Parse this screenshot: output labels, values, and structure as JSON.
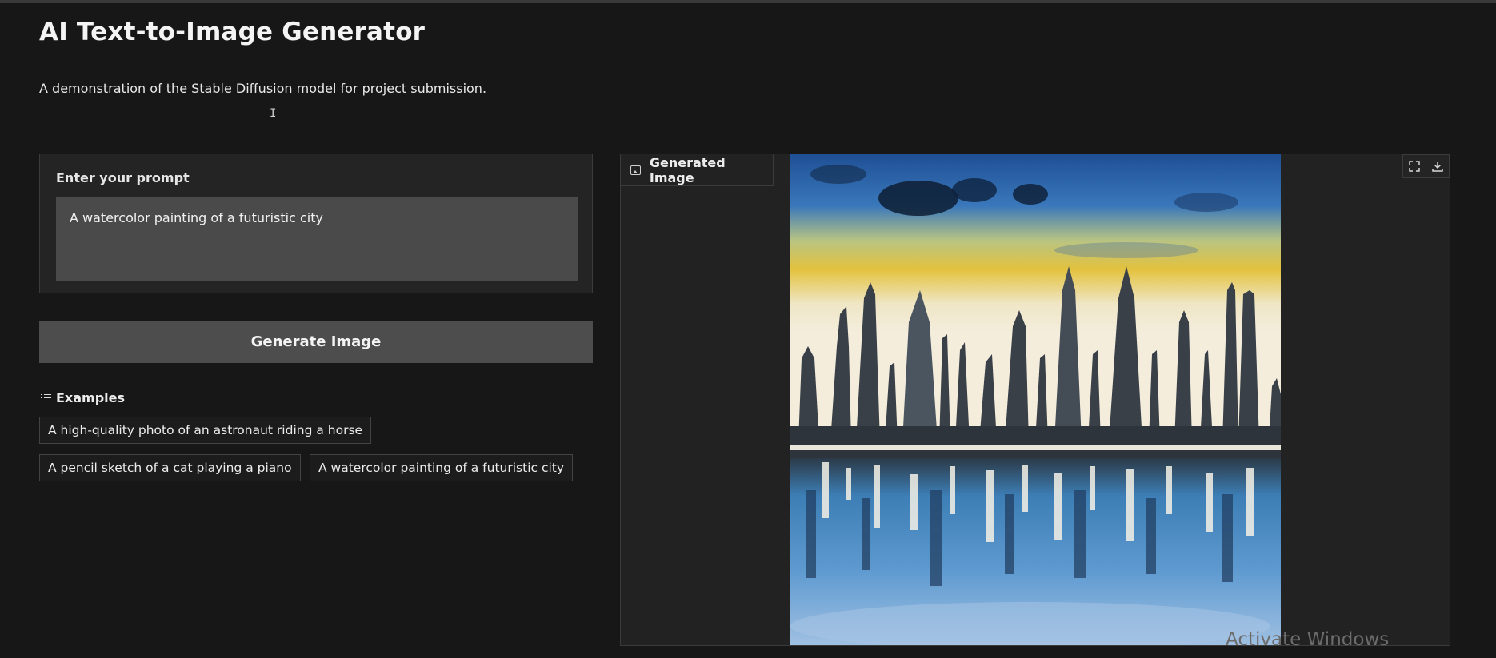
{
  "header": {
    "title": "AI Text-to-Image Generator",
    "subtitle": "A demonstration of the Stable Diffusion model for project submission."
  },
  "prompt": {
    "label": "Enter your prompt",
    "value": "A watercolor painting of a futuristic city"
  },
  "generate_button": {
    "label": "Generate Image"
  },
  "examples": {
    "label": "Examples",
    "items": [
      "A high-quality photo of an astronaut riding a horse",
      "A pencil sketch of a cat playing a piano",
      "A watercolor painting of a futuristic city"
    ]
  },
  "output": {
    "tab_label": "Generated Image",
    "tools": [
      "fullscreen-icon",
      "download-icon"
    ]
  },
  "os_overlay": {
    "watermark": "Activate Windows"
  }
}
